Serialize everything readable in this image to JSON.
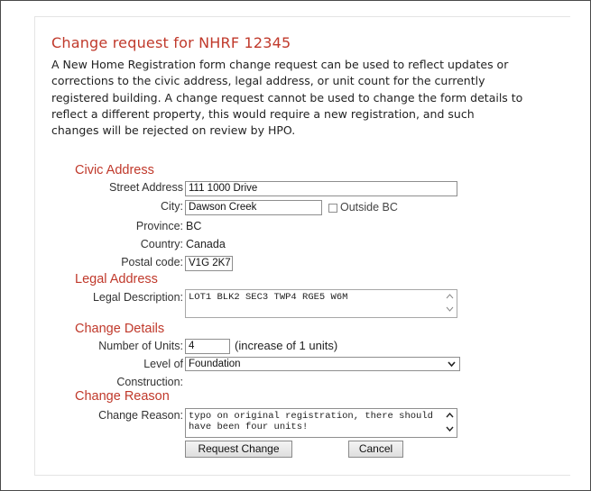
{
  "form": {
    "title": "Change request for NHRF 12345",
    "description_lines": [
      "A New Home Registration form change request can be used to reflect updates or",
      "corrections to the civic address, legal address, or unit count for the currently",
      "registered building. A change request cannot be used to change the form details to",
      "reflect a different property, this would require a new registration, and such",
      "changes will be rejected on review by HPO."
    ]
  },
  "civic_address": {
    "heading": "Civic Address",
    "street_label": "Street Address",
    "street_value": "111 1000 Drive",
    "city_label": "City:",
    "city_value": "Dawson Creek",
    "outside_bc_label": "Outside BC",
    "province_label": "Province:",
    "province_value": "BC",
    "country_label": "Country:",
    "country_value": "Canada",
    "postal_label": "Postal code:",
    "postal_value": "V1G 2K7"
  },
  "legal_address": {
    "heading": "Legal Address",
    "description_label": "Legal Description:",
    "description_value": "LOT1 BLK2 SEC3 TWP4 RGE5 W6M"
  },
  "change_details": {
    "heading": "Change Details",
    "units_label": "Number of Units:",
    "units_value": "4",
    "units_note": "(increase of 1 units)",
    "level_label_line1": "Level of",
    "level_label_line2": "Construction:",
    "level_value": "Foundation"
  },
  "change_reason": {
    "heading": "Change Reason",
    "reason_label": "Change Reason:",
    "reason_value": "typo on original registration, there should have been four units!"
  },
  "buttons": {
    "request_label": "Request Change",
    "cancel_label": "Cancel"
  },
  "icons": {
    "scroll_up": "scroll-up-arrow-icon",
    "scroll_down": "scroll-down-arrow-icon",
    "dropdown": "chevron-down-icon"
  },
  "colors": {
    "heading": "#c0392b",
    "text": "#222222",
    "border": "#8e8e8e"
  }
}
